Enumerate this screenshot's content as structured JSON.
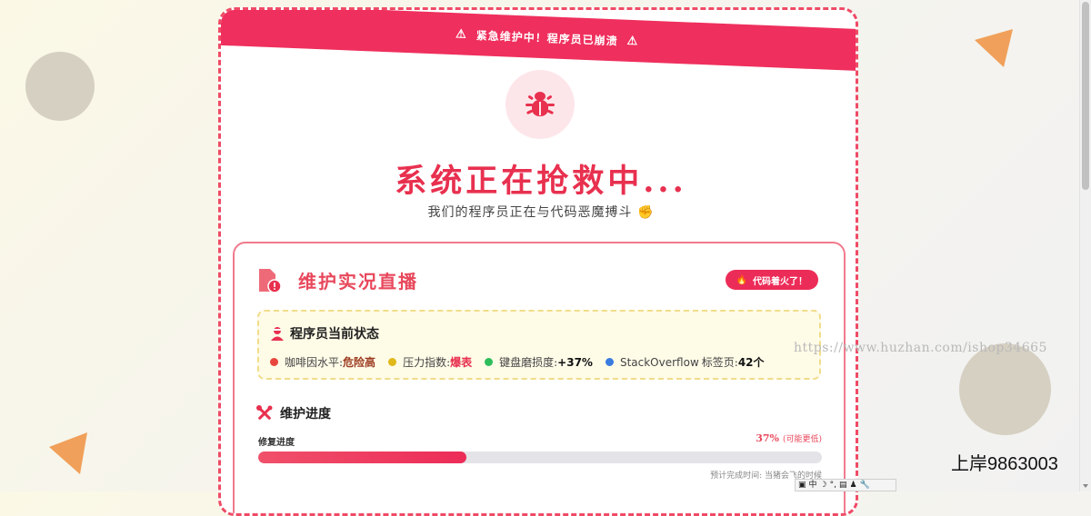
{
  "banner": {
    "text": "紧急维护中！程序员已崩溃",
    "icon": "warning-triangle-icon"
  },
  "hero": {
    "icon": "bug-icon",
    "title": "系统正在抢救中...",
    "subtitle": "我们的程序员正在与代码恶魔搏斗",
    "subtitle_icon": "fist-icon"
  },
  "panel": {
    "icon": "file-alert-icon",
    "title": "维护实况直播",
    "badge": {
      "icon": "fire-icon",
      "label": "代码着火了！"
    },
    "status": {
      "icon": "programmer-icon",
      "title": "程序员当前状态",
      "items": [
        {
          "label": "咖啡因水平:",
          "value": "危险高",
          "color": "#e8463c"
        },
        {
          "label": "压力指数:",
          "value": "爆表",
          "color": "#e0b81a"
        },
        {
          "label": "键盘磨损度:",
          "value": "+37%",
          "color": "#2ebd5b"
        },
        {
          "label_main": "StackOverflow",
          "label": "标签页:",
          "value": "42个",
          "color": "#3a7be0"
        }
      ]
    },
    "progress": {
      "icon": "tools-icon",
      "title": "维护进度",
      "label": "修复进度",
      "percent_text": "37%",
      "note": "(可能更低)",
      "fraction": 0.37,
      "eta": "预计完成时间: 当猪会飞的时候"
    }
  },
  "overlay": {
    "watermark": "https://www.huzhan.com/ishop34665",
    "brand": "上岸9863003",
    "ime": {
      "mode": "中",
      "symbols": [
        "☽",
        "°,",
        "▤",
        "♟",
        "🔧"
      ]
    }
  },
  "colors": {
    "accent": "#ef2f5d",
    "panel_border": "#f07a8c",
    "status_bg": "#fefbe7"
  }
}
